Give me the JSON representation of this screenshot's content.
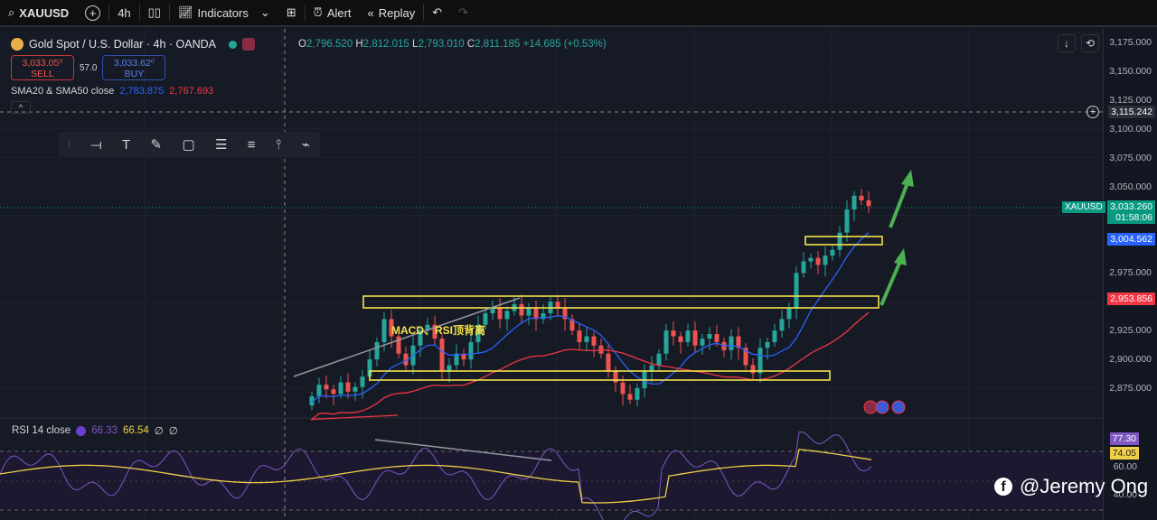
{
  "toolbar": {
    "symbol": "XAUUSD",
    "interval": "4h",
    "indicators": "Indicators",
    "alert": "Alert",
    "replay": "Replay"
  },
  "legend": {
    "title": "Gold Spot / U.S. Dollar · 4h · OANDA",
    "o_label": "O",
    "o": "2,796.520",
    "h_label": "H",
    "h": "2,812.015",
    "l_label": "L",
    "l": "2,793.010",
    "c_label": "C",
    "c": "2,811.185",
    "change": "+14.685 (+0.53%)",
    "sell_price": "3,033.05⁰",
    "sell_label": "SELL",
    "spread": "57.0",
    "buy_price": "3,033.62⁰",
    "buy_label": "BUY",
    "sma_label": "SMA20 & SMA50 close",
    "sma20": "2,783.875",
    "sma50": "2,767.693"
  },
  "axis": {
    "ticks": [
      "3,175.000",
      "3,150.000",
      "3,125.000",
      "3,100.000",
      "3,075.000",
      "3,050.000",
      "2,975.000",
      "2,925.000",
      "2,900.000",
      "2,875.000"
    ],
    "crosshair_price": "3,115.242",
    "symbol_tag": "XAUUSD",
    "last_price": "3,033.260",
    "countdown": "01:58:06",
    "sma20_price": "3,004.562",
    "sma50_price": "2,953.856",
    "rsi_value": "77.30",
    "rsi_ma": "74.05",
    "rsi_ticks": [
      "60.00",
      "40.00"
    ]
  },
  "rsi": {
    "label": "RSI 14 close",
    "v1": "66.33",
    "v2": "66.54",
    "v3": "∅",
    "v4": "∅"
  },
  "annotation": "MACD、RSI顶背离",
  "watermark": "@Jeremy Ong",
  "colors": {
    "up": "#26a69a",
    "down": "#ef5350",
    "sma20": "#2962ff",
    "sma50": "#f23645",
    "rect": "#f5e34a",
    "arrow": "#4caf50",
    "rsi": "#7e57c2",
    "rsi_ma": "#f0d048"
  },
  "chart_data": {
    "type": "candlestick",
    "symbol": "XAUUSD",
    "ylim": [
      2860,
      3175
    ],
    "closes": [
      2868,
      2878,
      2874,
      2870,
      2880,
      2872,
      2876,
      2885,
      2900,
      2915,
      2935,
      2920,
      2905,
      2895,
      2912,
      2925,
      2930,
      2918,
      2890,
      2895,
      2905,
      2900,
      2915,
      2930,
      2940,
      2945,
      2935,
      2942,
      2948,
      2938,
      2945,
      2935,
      2940,
      2950,
      2945,
      2935,
      2925,
      2915,
      2920,
      2912,
      2905,
      2890,
      2880,
      2870,
      2865,
      2875,
      2890,
      2895,
      2905,
      2925,
      2920,
      2915,
      2925,
      2912,
      2918,
      2922,
      2915,
      2908,
      2920,
      2910,
      2895,
      2888,
      2910,
      2915,
      2925,
      2935,
      2945,
      2975,
      2985,
      2988,
      2982,
      2990,
      2995,
      3010,
      3030,
      3042,
      3038,
      3033
    ]
  }
}
